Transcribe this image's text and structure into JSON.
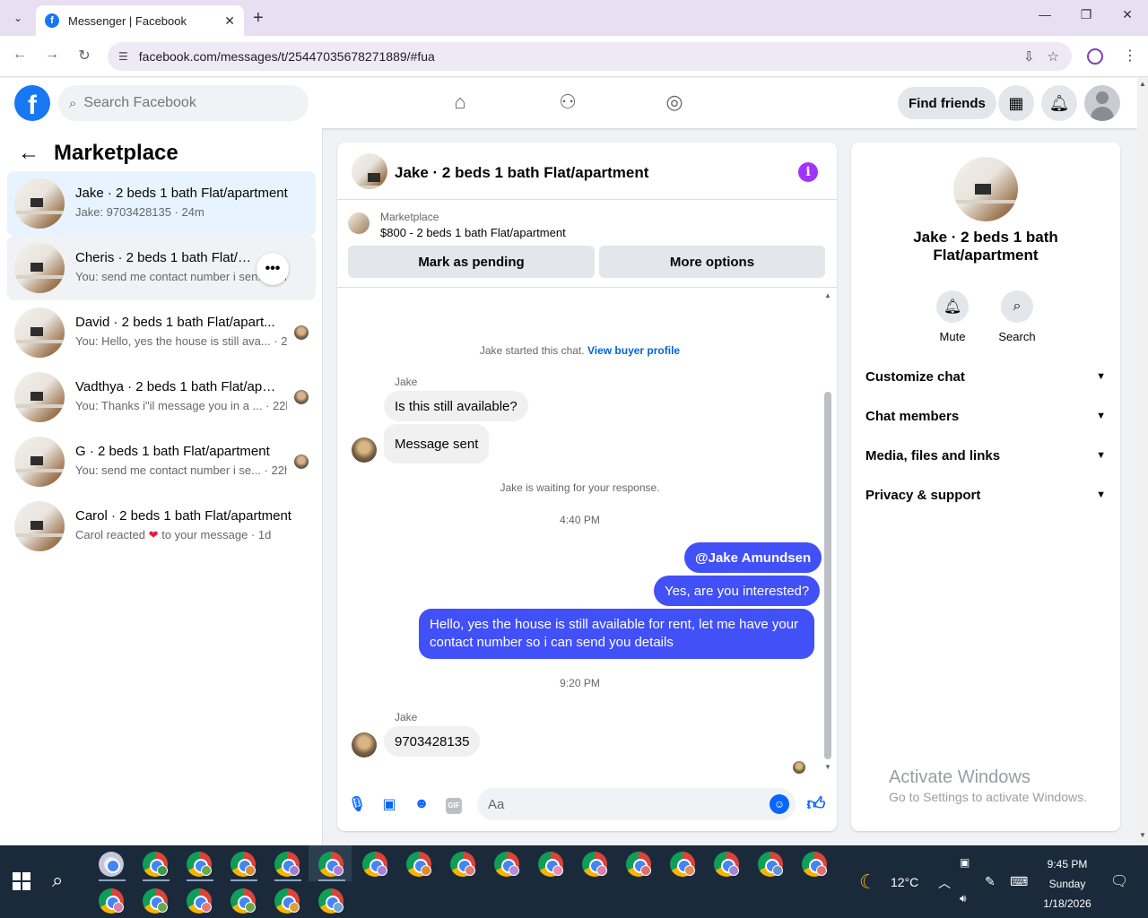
{
  "browser": {
    "tab_title": "Messenger | Facebook",
    "url": "facebook.com/messages/t/25447035678271889/#fua"
  },
  "fb": {
    "search_placeholder": "Search Facebook",
    "find_friends": "Find friends"
  },
  "left": {
    "title": "Marketplace",
    "conversations": [
      {
        "name": "Jake · 2 beds 1 bath Flat/apartment",
        "preview": "Jake: 9703428135 · 24m",
        "active": true
      },
      {
        "name": "Cheris · 2 beds 1 bath Flat/apar...",
        "preview": "You: send me contact number i sen... · 2m",
        "hover": true
      },
      {
        "name": "David · 2 beds 1 bath Flat/apart...",
        "preview": "You: Hello, yes the house is still ava... · 2h"
      },
      {
        "name": "Vadthya · 2 beds 1 bath Flat/apa...",
        "preview": "You: Thanks i\"il message you in a ... · 22h"
      },
      {
        "name": "G · 2 beds 1 bath Flat/apartment",
        "preview": "You: send me contact number i se... · 22h"
      },
      {
        "name": "Carol · 2 beds 1 bath Flat/apartment",
        "preview_a": "Carol reacted",
        "preview_b": "to your message · 1d"
      }
    ]
  },
  "chat": {
    "title": "Jake · 2 beds 1 bath Flat/apartment",
    "marketplace_label": "Marketplace",
    "listing": "$800 - 2 beds 1 bath Flat/apartment",
    "mark_pending": "Mark as pending",
    "more_options": "More options",
    "started": "Jake started this chat.",
    "view_profile": "View buyer profile",
    "sender1": "Jake",
    "msg1": "Is this still available?",
    "msg2": "Message sent",
    "waiting": "Jake is waiting for your response.",
    "time1": "4:40 PM",
    "out1": "@Jake Amundsen",
    "out2": "Yes, are you interested?",
    "out3": "Hello, yes the house is still available for rent, let me have your contact number so i can send you details",
    "time2": "9:20 PM",
    "sender2": "Jake",
    "msg3": "9703428135",
    "composer_placeholder": "Aa",
    "gif": "GIF"
  },
  "right": {
    "title": "Jake · 2 beds 1 bath Flat/apartment",
    "mute": "Mute",
    "search": "Search",
    "sections": [
      "Customize chat",
      "Chat members",
      "Media, files and links",
      "Privacy & support"
    ]
  },
  "watermark": {
    "line1": "Activate Windows",
    "line2": "Go to Settings to activate Windows."
  },
  "taskbar": {
    "weather": "12°C",
    "time": "9:45 PM",
    "day": "Sunday",
    "date": "1/18/2026"
  },
  "colors": {
    "fb_blue": "#1877f2",
    "outgoing_bubble": "#4150f7",
    "active_conv": "#e7f3ff",
    "info_purple": "#a033ff"
  }
}
